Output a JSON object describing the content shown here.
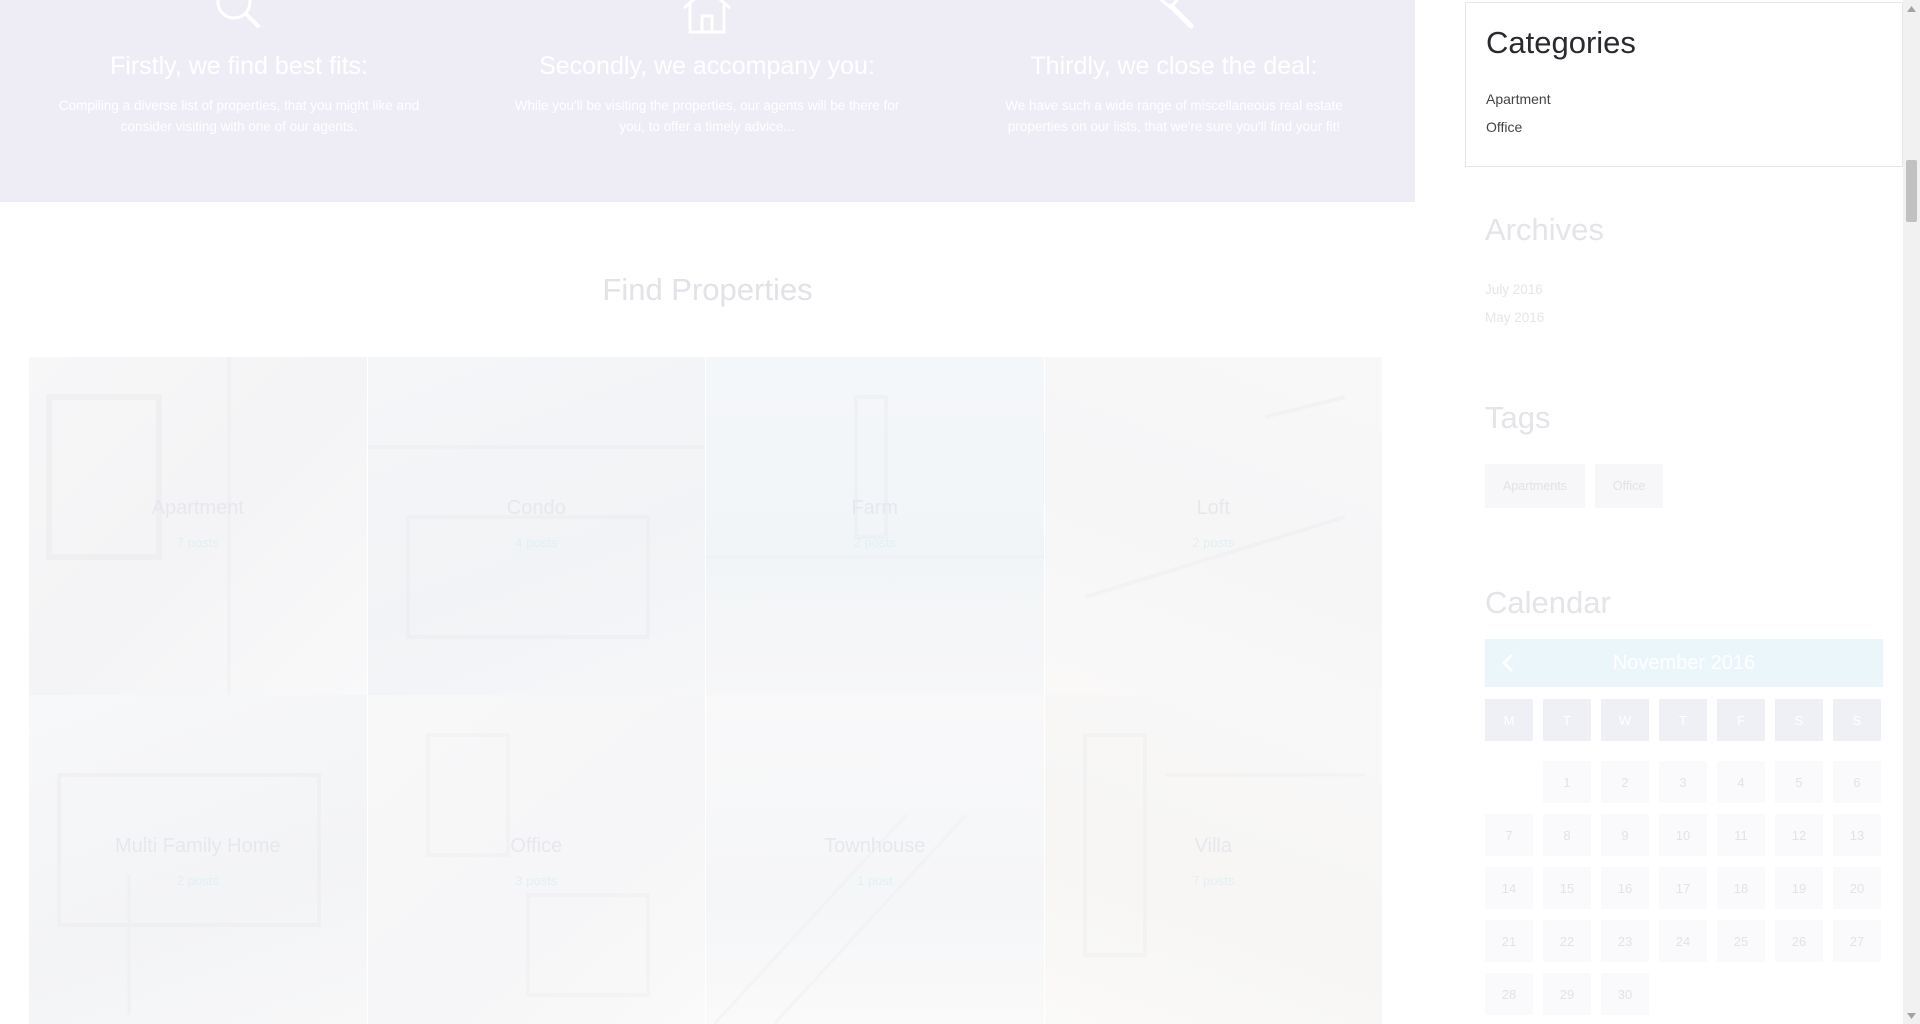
{
  "features": [
    {
      "icon": "search-icon",
      "title": "Firstly, we find best fits:",
      "text": "Compiling a diverse list of properties, that you might like and consider visiting with one of our agents."
    },
    {
      "icon": "house-icon",
      "title": "Secondly, we accompany you:",
      "text": "While you'll be visiting the properties, our agents will be there for you, to offer a timely advice..."
    },
    {
      "icon": "gavel-icon",
      "title": "Thirdly, we close the deal:",
      "text": "We have such a wide range of miscellaneous real estate properties on our lists, that we're sure you'll find your fit!"
    }
  ],
  "find_properties": {
    "title": "Find Properties",
    "tiles": [
      {
        "name": "Apartment",
        "count": "7 posts"
      },
      {
        "name": "Condo",
        "count": "4 posts"
      },
      {
        "name": "Farm",
        "count": "2 posts"
      },
      {
        "name": "Loft",
        "count": "2 posts"
      },
      {
        "name": "Multi Family Home",
        "count": "2 posts"
      },
      {
        "name": "Office",
        "count": "3 posts"
      },
      {
        "name": "Townhouse",
        "count": "1 post"
      },
      {
        "name": "Villa",
        "count": "7 posts"
      }
    ]
  },
  "sidebar": {
    "categories": {
      "title": "Categories",
      "items": [
        "Apartment",
        "Office"
      ]
    },
    "archives": {
      "title": "Archives",
      "items": [
        "July 2016",
        "May 2016"
      ]
    },
    "tags": {
      "title": "Tags",
      "items": [
        "Apartments",
        "Office"
      ]
    },
    "calendar": {
      "title": "Calendar",
      "month": "November 2016",
      "day_names": [
        "M",
        "T",
        "W",
        "T",
        "F",
        "S",
        "S"
      ],
      "weeks": [
        [
          "",
          "1",
          "2",
          "3",
          "4",
          "5",
          "6"
        ],
        [
          "7",
          "8",
          "9",
          "10",
          "11",
          "12",
          "13"
        ],
        [
          "14",
          "15",
          "16",
          "17",
          "18",
          "19",
          "20"
        ],
        [
          "21",
          "22",
          "23",
          "24",
          "25",
          "26",
          "27"
        ],
        [
          "28",
          "29",
          "30",
          "",
          "",
          "",
          ""
        ]
      ]
    }
  },
  "colors": {
    "hero_bg": "#eeedf6",
    "calendar_header_bg": "#ebf6fb"
  }
}
